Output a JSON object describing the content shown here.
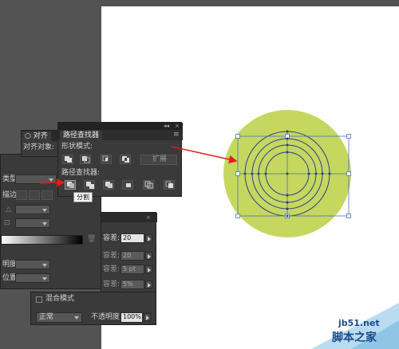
{
  "align_panel": {
    "tab_label": "○ 对齐",
    "align_to_label": "对齐对象:"
  },
  "pathfinder_panel": {
    "tab_label": "路径查找器",
    "shape_modes_label": "形状模式:",
    "expand_button": "扩展",
    "pathfinders_label": "路径查找器:",
    "tooltip": "分割"
  },
  "gradient_panel": {
    "type_label": "类型:",
    "stroke_label": "描边:",
    "opacity_label": "明度:",
    "location_label": "位置:"
  },
  "transform_panel": {
    "tolerance_label_1": "容差:",
    "tolerance_value_1": "20",
    "tolerance_label_2": "容差:",
    "tolerance_value_2": "20",
    "tolerance_label_3": "容差:",
    "tolerance_value_3": "5 pt",
    "tolerance_label_4": "容差:",
    "tolerance_value_4": "5%"
  },
  "transparency_panel": {
    "blend_mode_checkbox_label": "混合模式",
    "blend_mode_value": "正常",
    "opacity_label": "不透明度:",
    "opacity_value": "100%"
  },
  "artwork": {
    "fill_color": "#c5d75f",
    "stroke_color": "#2e3d8f",
    "arrow_color": "#e41a1a"
  },
  "watermark": {
    "site": "jb51.net",
    "name": "脚本之家"
  }
}
